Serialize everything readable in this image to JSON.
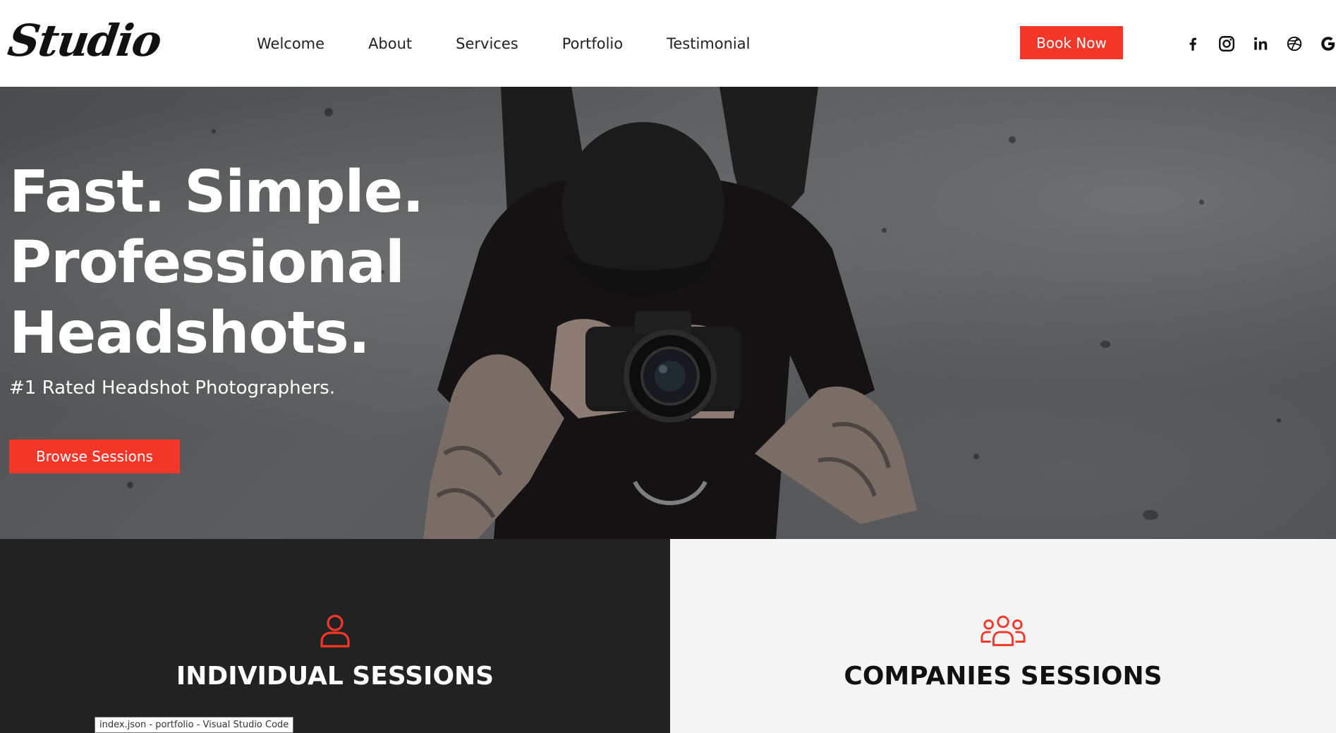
{
  "header": {
    "logo_text": "Studio",
    "nav": [
      "Welcome",
      "About",
      "Services",
      "Portfolio",
      "Testimonial"
    ],
    "book_label": "Book Now",
    "socials": [
      "facebook-icon",
      "instagram-icon",
      "linkedin-icon",
      "dribbble-icon",
      "google-icon"
    ]
  },
  "hero": {
    "title_lines": [
      "Fast. Simple.",
      "Professional",
      "Headshots."
    ],
    "subtitle": "#1 Rated Headshot Photographers.",
    "cta_label": "Browse Sessions"
  },
  "sessions": {
    "individual": {
      "title": "INDIVIDUAL SESSIONS",
      "icon": "user-icon"
    },
    "companies": {
      "title": "COMPANIES SESSIONS",
      "icon": "users-group-icon"
    }
  },
  "taskbar_tooltip": "index.json - portfolio - Visual Studio Code",
  "colors": {
    "accent": "#f5372a",
    "dark_panel": "#222222",
    "light_panel": "#f5f5f5"
  }
}
